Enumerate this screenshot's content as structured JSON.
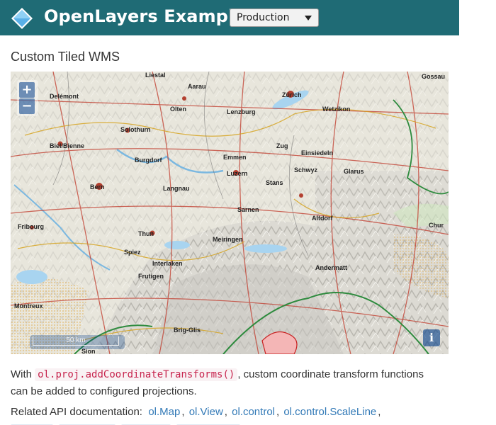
{
  "navbar": {
    "title": "OpenLayers Examples",
    "version_selected": "Production",
    "logo_icon": "openlayers-logo-icon"
  },
  "page": {
    "title": "Custom Tiled WMS"
  },
  "map": {
    "zoom_in_label": "+",
    "zoom_out_label": "−",
    "scale_text": "50 km",
    "info_label": "i",
    "place_labels": [
      "Liestal",
      "Zürich",
      "Gossau",
      "Delémont",
      "Solothurn",
      "Biel/Bienne",
      "Bern",
      "Thun",
      "Luzern",
      "Zug",
      "Schwyz",
      "Fribourg",
      "Spiez",
      "Brig-Glis",
      "Sion",
      "Montreux",
      "Aarau",
      "Olten",
      "Emmen",
      "Altdorf",
      "Einsiedeln",
      "Glarus",
      "Chur",
      "Interlaken",
      "Meiringen",
      "Andermatt",
      "Wetzikon",
      "Lenzburg",
      "Burgdorf",
      "Langnau",
      "Sarnen",
      "Stans",
      "Frutigen"
    ]
  },
  "description": {
    "prefix": "With ",
    "code": "ol.proj.addCoordinateTransforms()",
    "suffix": ", custom coordinate transform functions can be added to configured projections."
  },
  "api": {
    "label": "Related API documentation:",
    "links": [
      "ol.Map",
      "ol.View",
      "ol.control",
      "ol.control.ScaleLine"
    ]
  },
  "colors": {
    "navbar": "#1f6b75",
    "link": "#337ab7",
    "code_text": "#c7254e"
  }
}
